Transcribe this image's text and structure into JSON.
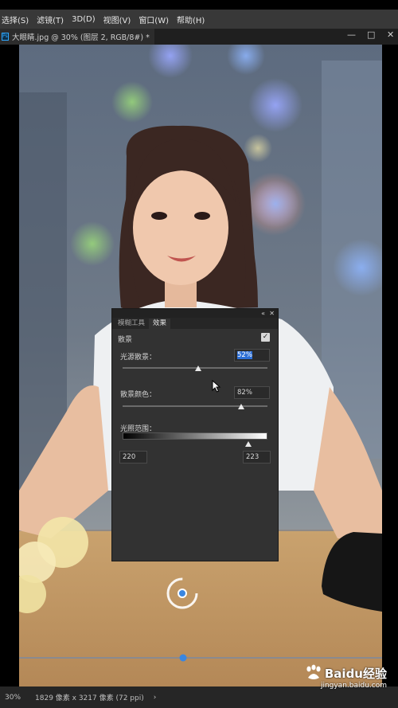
{
  "menubar": {
    "items": [
      "选择(S)",
      "滤镜(T)",
      "3D(D)",
      "视图(V)",
      "窗口(W)",
      "帮助(H)"
    ]
  },
  "document": {
    "tab_title": "大眼睛.jpg @ 30% (图层 2, RGB/8#) *",
    "ps_icon": "Ps"
  },
  "window_controls": {
    "minimize": "—",
    "restore": "□",
    "close": "✕"
  },
  "panel": {
    "collapse_icon": "«",
    "close_icon": "✕",
    "tabs": [
      "模糊工具",
      "效果"
    ],
    "active_tab": 1,
    "bokeh_label": "散景",
    "bokeh_checked": true,
    "light_bokeh_label": "光源散景：",
    "light_bokeh_value": "52%",
    "light_bokeh_level": 0.52,
    "bokeh_color_label": "散景颜色：",
    "bokeh_color_value": "82%",
    "bokeh_color_level": 0.82,
    "light_range_label": "光照范围：",
    "light_range_low": "220",
    "light_range_high": "223",
    "light_range_level": 0.87
  },
  "status": {
    "zoom": "30%",
    "size_info": "1829 像素 x 3217 像素 (72 ppi)",
    "arrow": "›"
  },
  "watermark": {
    "logo": "Baiéç¾åº¦ç»éª",
    "logo_text": "Baidu经验",
    "url": "jingyan.baidu.com"
  },
  "colors": {
    "accent": "#2d6fd6",
    "pin": "#3a86e0",
    "panel_bg": "#323232",
    "menubar_bg": "#383838"
  }
}
